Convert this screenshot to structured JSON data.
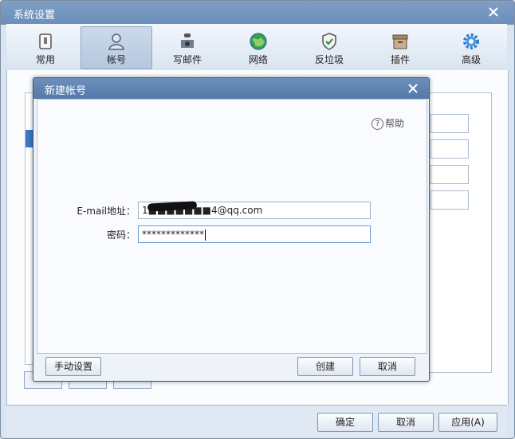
{
  "window": {
    "title": "系统设置"
  },
  "toolbar": {
    "items": [
      {
        "label": "常用",
        "icon": "general-icon"
      },
      {
        "label": "帐号",
        "icon": "account-icon",
        "active": true
      },
      {
        "label": "写邮件",
        "icon": "compose-icon"
      },
      {
        "label": "网络",
        "icon": "network-icon"
      },
      {
        "label": "反垃圾",
        "icon": "antispam-icon"
      },
      {
        "label": "插件",
        "icon": "plugin-icon"
      },
      {
        "label": "高级",
        "icon": "advanced-icon"
      }
    ]
  },
  "dialog": {
    "title": "新建帐号",
    "help_label": "帮助",
    "email": {
      "label": "E-mail地址：",
      "value": "1■■■■■■■4@qq.com"
    },
    "password": {
      "label": "密码：",
      "value": "*************"
    },
    "buttons": {
      "manual": "手动设置",
      "create": "创建",
      "cancel": "取消"
    }
  },
  "footer": {
    "ok": "确定",
    "cancel": "取消",
    "apply": "应用(A)"
  },
  "colors": {
    "title_bar": "#6a8fba",
    "dialog_title": "#5479a8",
    "selection": "#3b78c6"
  }
}
